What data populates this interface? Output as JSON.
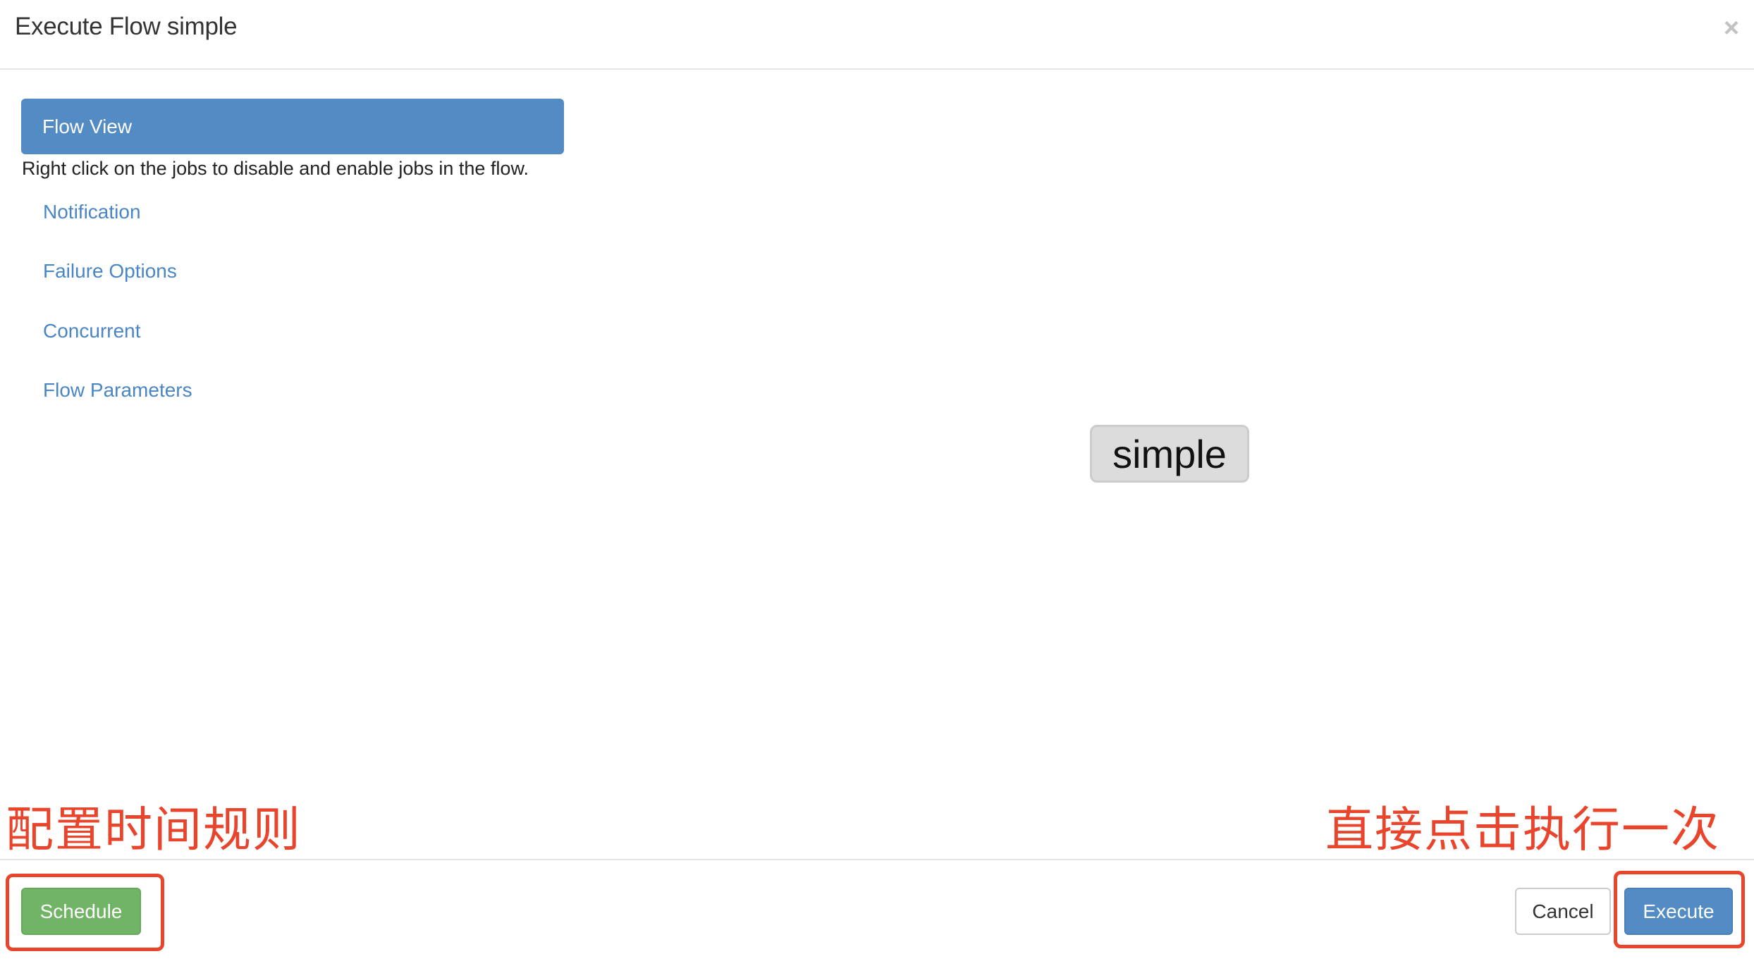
{
  "header": {
    "title": "Execute Flow simple",
    "close_icon": "×"
  },
  "sidebar": {
    "active_item": "Flow View",
    "help_text": "Right click on the jobs to disable and enable jobs in the flow.",
    "items": [
      {
        "label": "Notification"
      },
      {
        "label": "Failure Options"
      },
      {
        "label": "Concurrent"
      },
      {
        "label": "Flow Parameters"
      }
    ]
  },
  "graph": {
    "nodes": [
      {
        "label": "simple"
      }
    ]
  },
  "annotations": {
    "left": "配置时间规则",
    "right": "直接点击执行一次",
    "color": "#e8452c"
  },
  "footer": {
    "schedule_label": "Schedule",
    "cancel_label": "Cancel",
    "execute_label": "Execute"
  },
  "colors": {
    "primary": "#538bc5",
    "success": "#72b466",
    "link": "#4a86c5"
  }
}
